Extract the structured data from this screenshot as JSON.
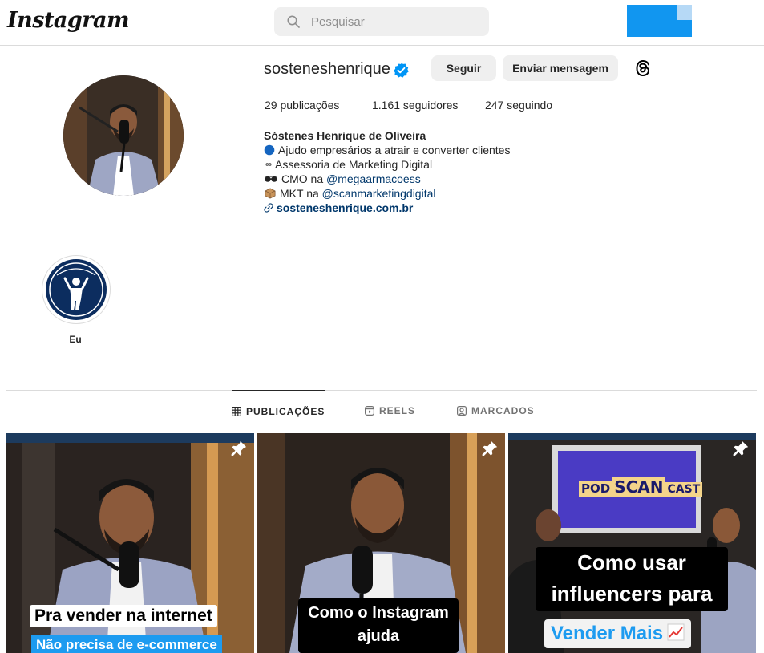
{
  "header": {
    "logo": "Instagram",
    "search_placeholder": "Pesquisar"
  },
  "profile": {
    "username": "sosteneshenrique",
    "follow_label": "Seguir",
    "message_label": "Enviar mensagem",
    "stats": {
      "posts": "29 publicações",
      "followers": "1.161 seguidores",
      "following": "247 seguindo"
    },
    "bio": {
      "name": "Sóstenes Henrique de Oliveira",
      "line1": "Ajudo empresários a atrair e converter clientes",
      "line2": "Assessoria de Marketing Digital",
      "line3_prefix": "CMO na ",
      "line3_link": "@megaarmacoess",
      "line4_prefix": "MKT na ",
      "line4_link": "@scanmarketingdigital",
      "website": "sosteneshenrique.com.br"
    }
  },
  "highlights": [
    {
      "label": "Eu"
    }
  ],
  "tabs": [
    {
      "label": "PUBLICAÇÕES",
      "active": true,
      "icon": "grid-icon"
    },
    {
      "label": "REELS",
      "active": false,
      "icon": "reels-icon"
    },
    {
      "label": "MARCADOS",
      "active": false,
      "icon": "tagged-icon"
    }
  ],
  "posts": [
    {
      "caption1": "Pra vender na internet",
      "caption2": "Não precisa de e-commerce",
      "pinned": true
    },
    {
      "caption1": "Como o Instagram ajuda",
      "pinned": true
    },
    {
      "logo_text1": "POD",
      "logo_text2": "SCAN",
      "logo_text3": "CAST",
      "caption1": "Como usar influencers para",
      "caption2": "Vender Mais",
      "pinned": true
    }
  ],
  "colors": {
    "accent_blue": "#0095f6",
    "link": "#00376b",
    "button_bg": "#efefef"
  }
}
